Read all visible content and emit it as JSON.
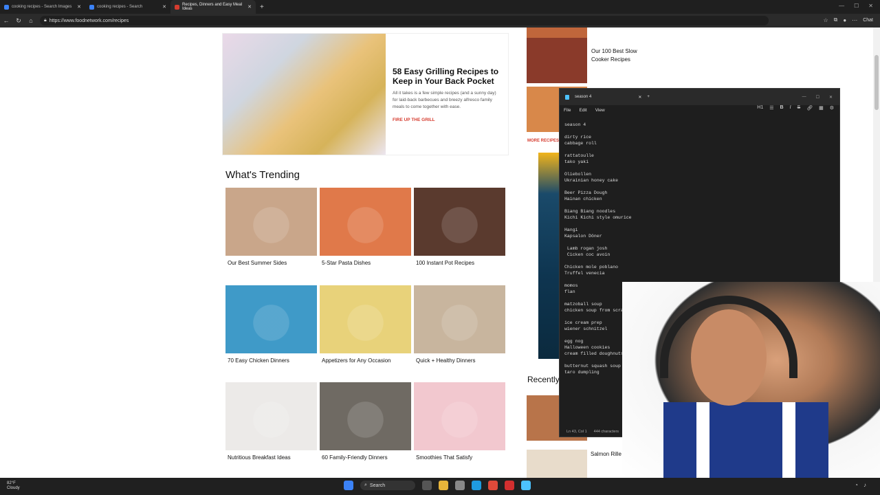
{
  "browser": {
    "tabs": [
      {
        "label": "cooking recipes - Search Images",
        "active": false
      },
      {
        "label": "cooking recipes - Search",
        "active": false
      },
      {
        "label": "Recipes, Dinners and Easy Meal Ideas",
        "active": true
      }
    ],
    "url": "https://www.foodnetwork.com/recipes",
    "chat_label": "Chat"
  },
  "hero": {
    "title": "58 Easy Grilling Recipes to Keep in Your Back Pocket",
    "description": "All it takes is a few simple recipes (and a sunny day) for laid-back barbecues and breezy alfresco family meals to come together with ease.",
    "cta": "FIRE UP THE GRILL"
  },
  "trending": {
    "heading": "What's Trending",
    "cards": [
      {
        "label": "Our Best Summer Sides",
        "color": "#c9a68a"
      },
      {
        "label": "5-Star Pasta Dishes",
        "color": "#e0794a"
      },
      {
        "label": "100 Instant Pot Recipes",
        "color": "#5a3a2e"
      },
      {
        "label": "70 Easy Chicken Dinners",
        "color": "#3f9ac8"
      },
      {
        "label": "Appetizers for Any Occasion",
        "color": "#e8d27a"
      },
      {
        "label": "Quick + Healthy Dinners",
        "color": "#c8b59e"
      },
      {
        "label": "Nutritious Breakfast Ideas",
        "color": "#eceae8"
      },
      {
        "label": "60 Family-Friendly Dinners",
        "color": "#6f6a63"
      },
      {
        "label": "Smoothies That Satisfy",
        "color": "#f2c8cf"
      }
    ]
  },
  "sidebar": {
    "item_label": "Our 100 Best Slow Cooker Recipes",
    "more": "MORE RECIPES",
    "recently": "Recently",
    "salmon": "Salmon Rille"
  },
  "notepad": {
    "tab_title": "season 4",
    "menu": [
      "File",
      "Edit",
      "View"
    ],
    "heading_btn": "H1",
    "content": "season 4\n\ndirty rice\ncabbage roll\n\nrattatoulle\ntako yaki\n\nOliebollen\nUkrainian honey cake\n\nBeer Pizza Dough\nHainan chicken\n\nBiang Biang noodles\nKichi Kichi style omurice\n\nHangi\nKapsalon Döner\n\n Lamb rogan josh\n Cicken coc avoin\n\nChicken mole poblano\nTruffel venecia\n\nmomos\nflan\n\nmatzoball soup\nchicken soup from scratch\n\nice cream prep\nwiener schnitzel\n\negg nog\nHalloween cookies\ncream filled doughnuts\n\nbutternut squash soup\ntaro dumpling",
    "status_position": "Ln 43, Col 1",
    "status_chars": "444 characters"
  },
  "taskbar": {
    "temp": "82°F",
    "condition": "Cloudy",
    "search_label": "Search"
  }
}
